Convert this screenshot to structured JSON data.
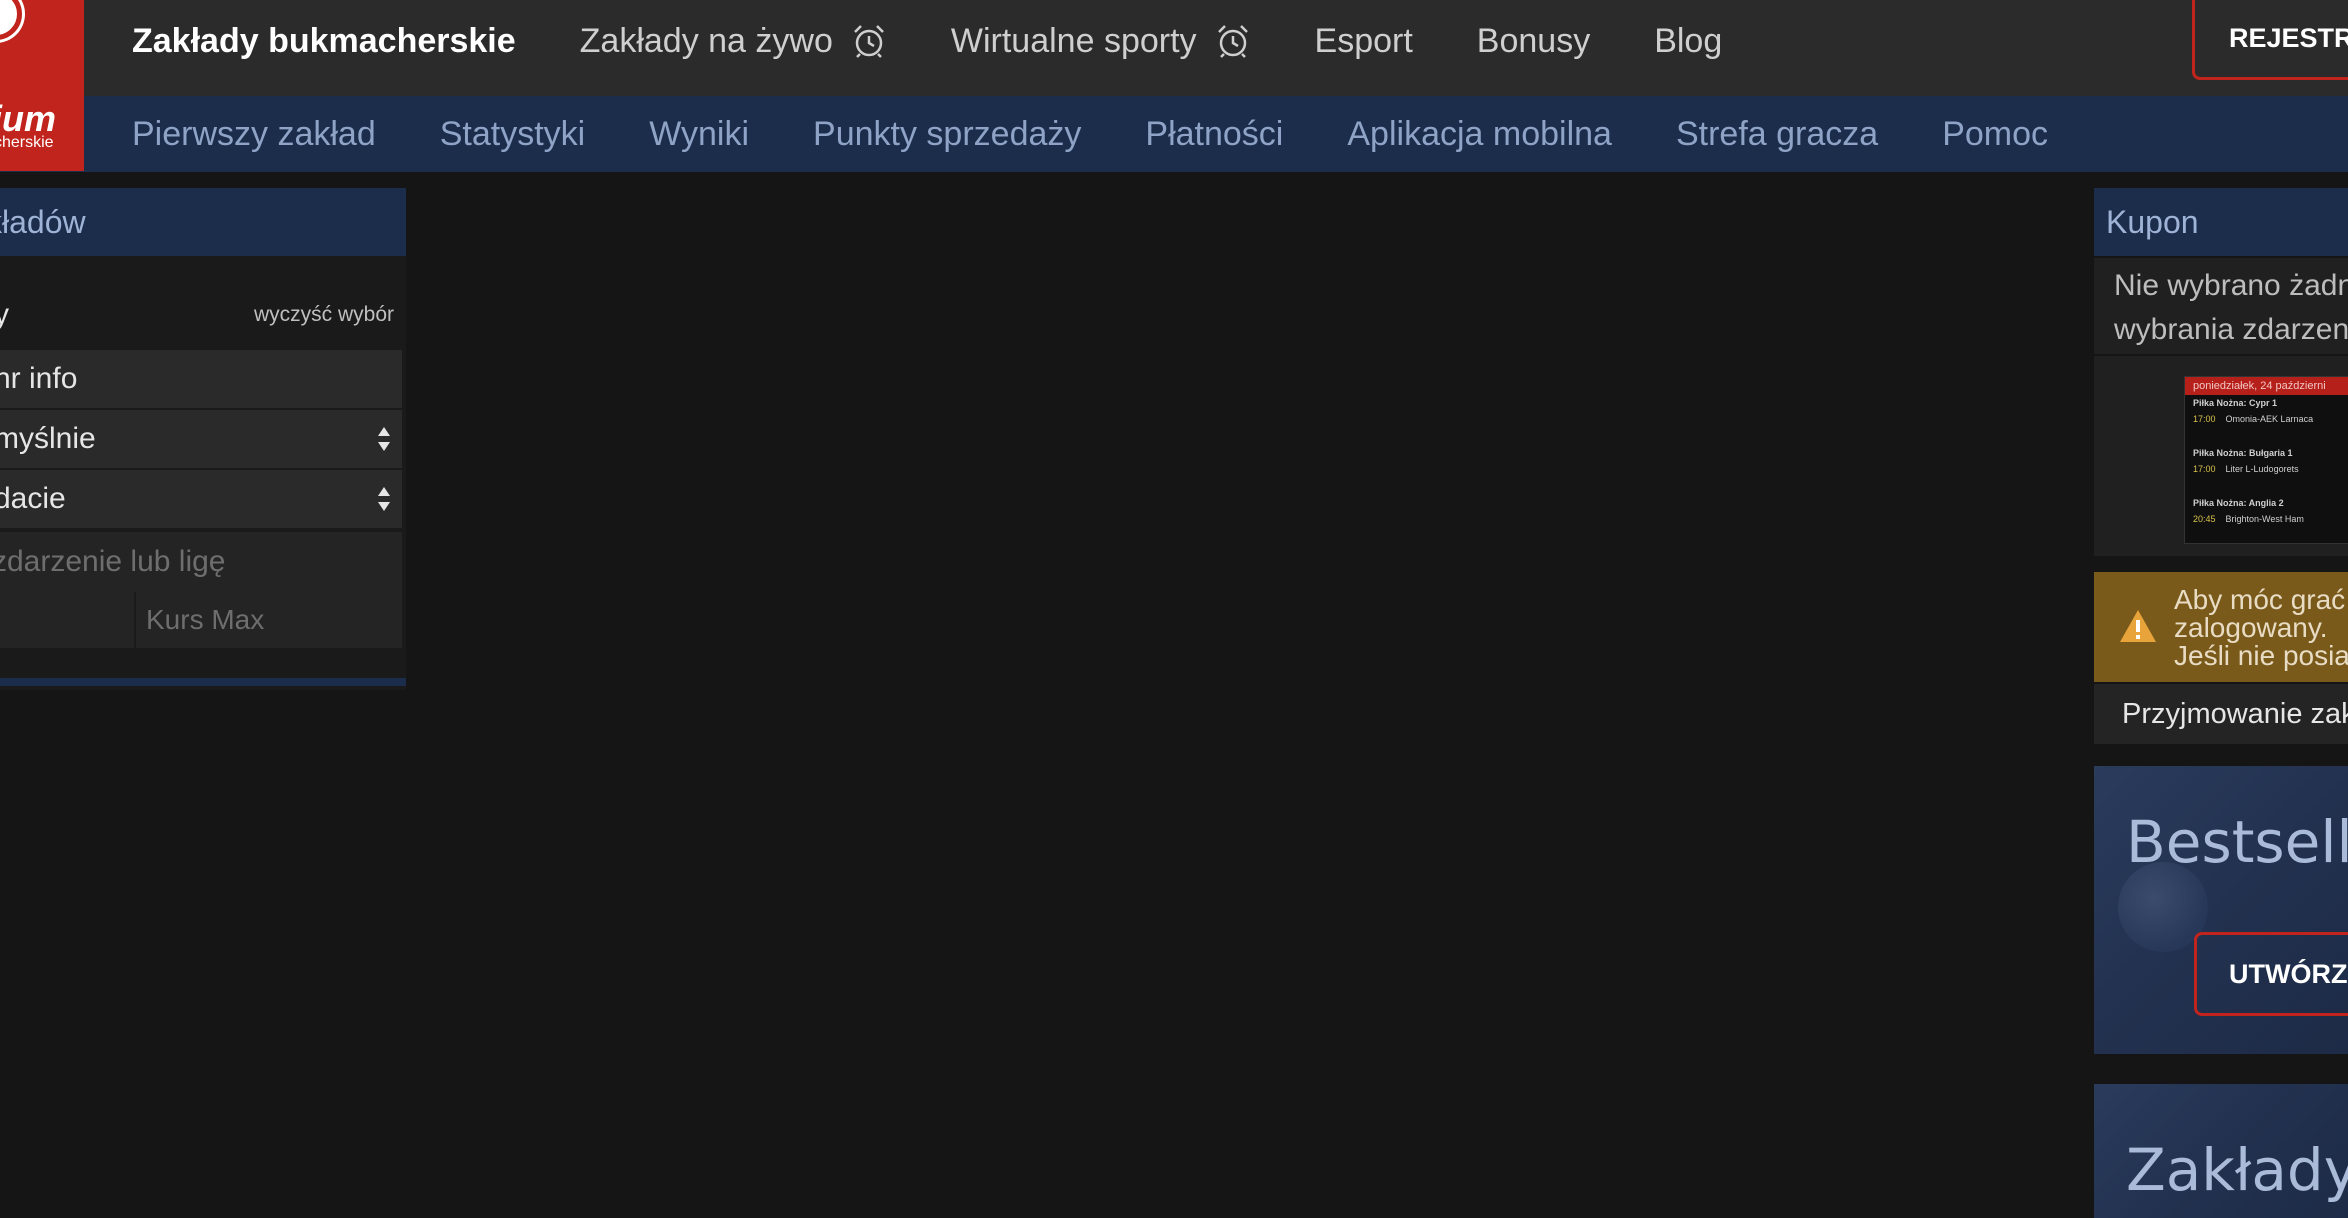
{
  "logo": {
    "word": "ium",
    "sub": "cherskie"
  },
  "main_nav": [
    {
      "label": "Zakłady bukmacherskie",
      "icon": "",
      "active": true
    },
    {
      "label": "Zakłady na żywo",
      "icon": "alarm-clock-icon",
      "active": false
    },
    {
      "label": "Wirtualne sporty",
      "icon": "alarm-clock-icon",
      "active": false
    },
    {
      "label": "Esport",
      "icon": "",
      "active": false
    },
    {
      "label": "Bonusy",
      "icon": "",
      "active": false
    },
    {
      "label": "Blog",
      "icon": "",
      "active": false
    }
  ],
  "register_label": "REJESTRA",
  "sub_nav": [
    "Pierwszy zakład",
    "Statystyki",
    "Wyniki",
    "Punkty sprzedaży",
    "Płatności",
    "Aplikacja mobilna",
    "Strefa gracza",
    "Pomoc"
  ],
  "left_panel": {
    "header": "kładów",
    "filter_label": "y",
    "clear_label": "wyczyść wybór",
    "info_label": "nr info",
    "sort_value": "myślnie",
    "time_value": "dacie",
    "search_placeholder": "zdarzenie lub ligę",
    "kurs_max_placeholder": "Kurs Max"
  },
  "coupon": {
    "title": "Kupon",
    "message_line1": "Nie wybrano żadnyc",
    "message_line2": "wybrania zdarzenia",
    "ticket": {
      "date": "poniedziałek, 24 październi",
      "groups": [
        {
          "league": "Piłka Nożna: Cypr 1",
          "time": "17:00",
          "match": "Omonia-AEK Larnaca"
        },
        {
          "league": "Piłka Nożna: Bułgaria 1",
          "time": "17:00",
          "match": "Liter L-Ludogorets"
        },
        {
          "league": "Piłka Nożna: Anglia 2",
          "time": "20:45",
          "match": "Brighton-West Ham"
        }
      ]
    },
    "warning_line1": "Aby móc grać p",
    "warning_line2": "zalogowany.",
    "warning_line3": "Jeśli nie posiad",
    "accept_label": "Przyjmowanie zakła"
  },
  "promo1": {
    "title": "Bestseller",
    "button": "UTWÓRZ S"
  },
  "promo2": {
    "title": "Zakłady n"
  },
  "colors": {
    "brand_red": "#c1241c",
    "top_bar": "#2b2b2b",
    "sub_bar": "#1c2d4c",
    "background": "#151515",
    "warning": "#7a5a1a"
  }
}
